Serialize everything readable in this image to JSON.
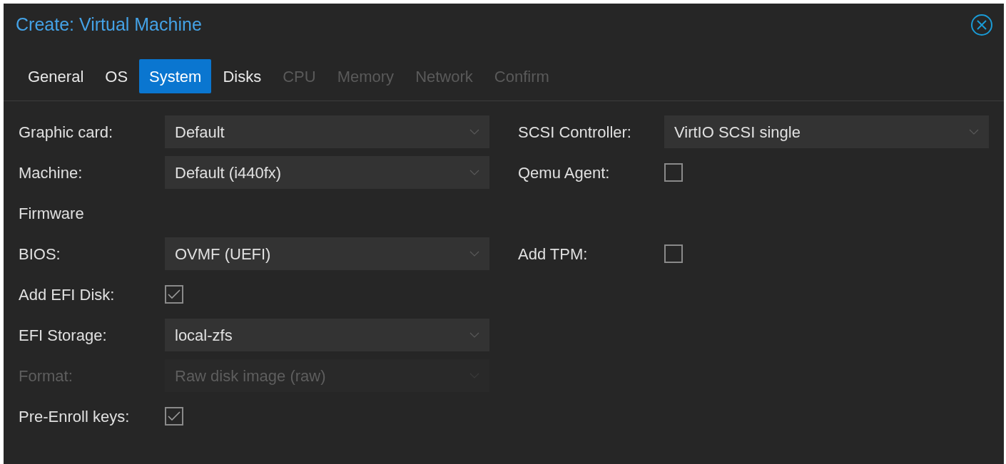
{
  "window": {
    "title": "Create: Virtual Machine"
  },
  "tabs": [
    {
      "label": "General",
      "selected": false,
      "disabled": false
    },
    {
      "label": "OS",
      "selected": false,
      "disabled": false
    },
    {
      "label": "System",
      "selected": true,
      "disabled": false
    },
    {
      "label": "Disks",
      "selected": false,
      "disabled": false
    },
    {
      "label": "CPU",
      "selected": false,
      "disabled": true
    },
    {
      "label": "Memory",
      "selected": false,
      "disabled": true
    },
    {
      "label": "Network",
      "selected": false,
      "disabled": true
    },
    {
      "label": "Confirm",
      "selected": false,
      "disabled": true
    }
  ],
  "rows": [
    {
      "left": {
        "kind": "combo",
        "label": "Graphic card:",
        "value": "Default",
        "disabled": false
      },
      "right": {
        "kind": "combo",
        "label": "SCSI Controller:",
        "value": "VirtIO SCSI single",
        "disabled": false
      }
    },
    {
      "left": {
        "kind": "combo",
        "label": "Machine:",
        "value": "Default (i440fx)",
        "disabled": false
      },
      "right": {
        "kind": "checkbox",
        "label": "Qemu Agent:",
        "checked": false,
        "disabled": false
      }
    },
    {
      "left": {
        "kind": "heading",
        "label": "Firmware"
      }
    },
    {
      "left": {
        "kind": "combo",
        "label": "BIOS:",
        "value": "OVMF (UEFI)",
        "disabled": false
      },
      "right": {
        "kind": "checkbox",
        "label": "Add TPM:",
        "checked": false,
        "disabled": false
      }
    },
    {
      "left": {
        "kind": "checkbox",
        "label": "Add EFI Disk:",
        "checked": true,
        "disabled": false
      }
    },
    {
      "left": {
        "kind": "combo",
        "label": "EFI Storage:",
        "value": "local-zfs",
        "disabled": false
      }
    },
    {
      "left": {
        "kind": "combo",
        "label": "Format:",
        "value": "Raw disk image (raw)",
        "disabled": true
      }
    },
    {
      "left": {
        "kind": "checkbox",
        "label": "Pre-Enroll keys:",
        "checked": true,
        "disabled": false
      }
    }
  ]
}
